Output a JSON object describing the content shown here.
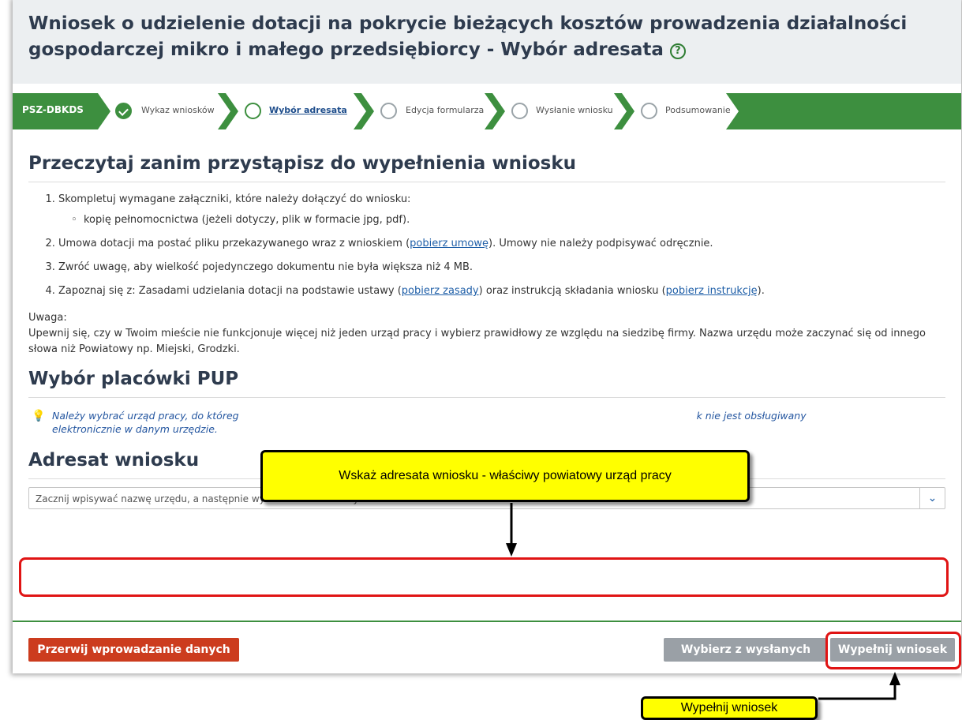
{
  "page_title": "Wniosek o udzielenie dotacji na pokrycie bieżących kosztów prowadzenia działalności gospodarczej mikro i małego przedsiębiorcy - Wybór adresata",
  "help_symbol": "?",
  "stepbar": {
    "tag": "PSZ-DBKDS",
    "steps": [
      {
        "label": "Wykaz wniosków",
        "state": "done"
      },
      {
        "label": "Wybór adresata",
        "state": "current"
      },
      {
        "label": "Edycja formularza",
        "state": "todo"
      },
      {
        "label": "Wysłanie wniosku",
        "state": "todo"
      },
      {
        "label": "Podsumowanie",
        "state": "todo"
      }
    ]
  },
  "read_heading": "Przeczytaj zanim przystąpisz do wypełnienia wniosku",
  "instructions": {
    "item1": "Skompletuj wymagane załączniki, które należy dołączyć do wniosku:",
    "item1_sub": "kopię pełnomocnictwa (jeżeli dotyczy, plik w formacie jpg, pdf).",
    "item2_pre": "Umowa dotacji ma postać pliku przekazywanego wraz z wnioskiem (",
    "item2_link": "pobierz umowę",
    "item2_post": "). Umowy nie należy podpisywać odręcznie.",
    "item3": "Zwróć uwagę, aby wielkość pojedynczego dokumentu nie była większa niż 4 MB.",
    "item4_pre": "Zapoznaj się z: Zasadami udzielania dotacji na podstawie ustawy (",
    "item4_link1": "pobierz zasady",
    "item4_mid": ") oraz instrukcją składania wniosku (",
    "item4_link2": "pobierz instrukcję",
    "item4_post": ")."
  },
  "note_label": "Uwaga:",
  "note_text": "Upewnij się, czy w Twoim mieście nie funkcjonuje więcej niż jeden urząd pracy i wybierz prawidłowy ze względu na siedzibę firmy. Nazwa urzędu może zaczynać się od innego słowa niż Powiatowy np. Miejski, Grodzki.",
  "pup_heading": "Wybór placówki PUP",
  "hint_part1": "Należy wybrać urząd pracy, do któreg",
  "hint_part2": "k nie jest obsługiwany",
  "hint_part3": "elektronicznie w danym urzędzie.",
  "addressee_heading": "Adresat wniosku",
  "select_placeholder": "Zacznij wpisywać nazwę urzędu, a następnie wybierz wartość z listy",
  "buttons": {
    "cancel": "Przerwij wprowadzanie danych",
    "choose_sent": "Wybierz z wysłanych",
    "fill": "Wypełnij wniosek"
  },
  "callouts": {
    "top": "Wskaż adresata wniosku - właściwy powiatowy urząd pracy",
    "bottom": "Wypełnij wniosek"
  },
  "colors": {
    "green": "#3d8f3f",
    "cancel_red": "#cc3c1e",
    "disabled_grey": "#9aa0a6",
    "callout_yellow": "#ffff00",
    "highlight_red": "#e01414"
  }
}
